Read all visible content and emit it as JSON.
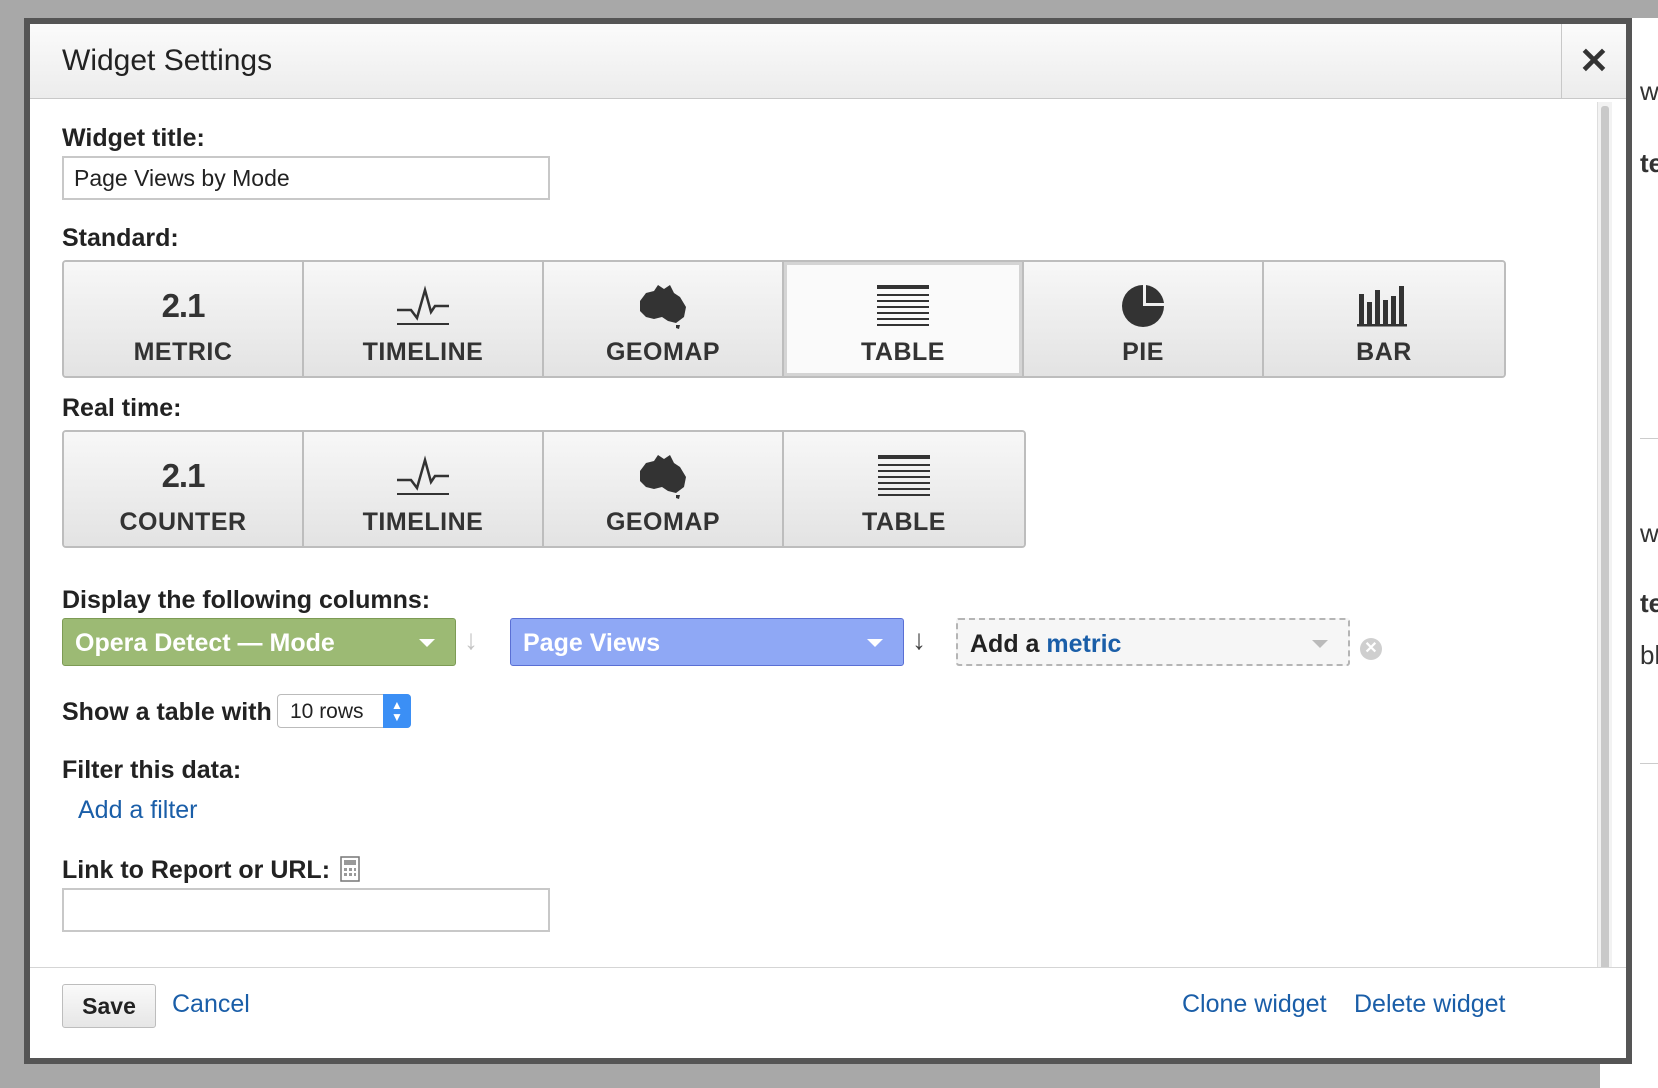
{
  "dialog": {
    "title": "Widget Settings",
    "close_icon": "close-icon"
  },
  "form": {
    "widget_title_label": "Widget title:",
    "widget_title_value": "Page Views by Mode",
    "standard_label": "Standard:",
    "standard_options": [
      {
        "label": "METRIC",
        "icon": "metric-2.1-icon",
        "icon_text": "2.1",
        "selected": false
      },
      {
        "label": "TIMELINE",
        "icon": "timeline-icon",
        "selected": false
      },
      {
        "label": "GEOMAP",
        "icon": "australia-map-icon",
        "selected": false
      },
      {
        "label": "TABLE",
        "icon": "table-icon",
        "selected": true
      },
      {
        "label": "PIE",
        "icon": "pie-chart-icon",
        "selected": false
      },
      {
        "label": "BAR",
        "icon": "bar-chart-icon",
        "selected": false
      }
    ],
    "realtime_label": "Real time:",
    "realtime_options": [
      {
        "label": "COUNTER",
        "icon": "counter-2.1-icon",
        "icon_text": "2.1"
      },
      {
        "label": "TIMELINE",
        "icon": "timeline-icon"
      },
      {
        "label": "GEOMAP",
        "icon": "australia-map-icon"
      },
      {
        "label": "TABLE",
        "icon": "table-icon"
      }
    ],
    "columns_label": "Display the following columns:",
    "columns": {
      "dimension": "Opera Detect — Mode",
      "metric": "Page Views",
      "add_metric_prefix": "Add a",
      "add_metric_link": "metric"
    },
    "rows_label": "Show a table with",
    "rows_value": "10 rows",
    "filter_label": "Filter this data:",
    "add_filter_link": "Add a filter",
    "link_label": "Link to Report or URL:",
    "link_value": ""
  },
  "footer": {
    "save": "Save",
    "cancel": "Cancel",
    "clone": "Clone widget",
    "delete": "Delete widget"
  },
  "colors": {
    "dimension_pill": "#9cba74",
    "metric_pill": "#8fa8f5",
    "link": "#1a5ea8",
    "stepper": "#3b8ff5"
  },
  "background_page": {
    "fragments": [
      "w",
      "te",
      "w",
      "te",
      "bl"
    ]
  }
}
